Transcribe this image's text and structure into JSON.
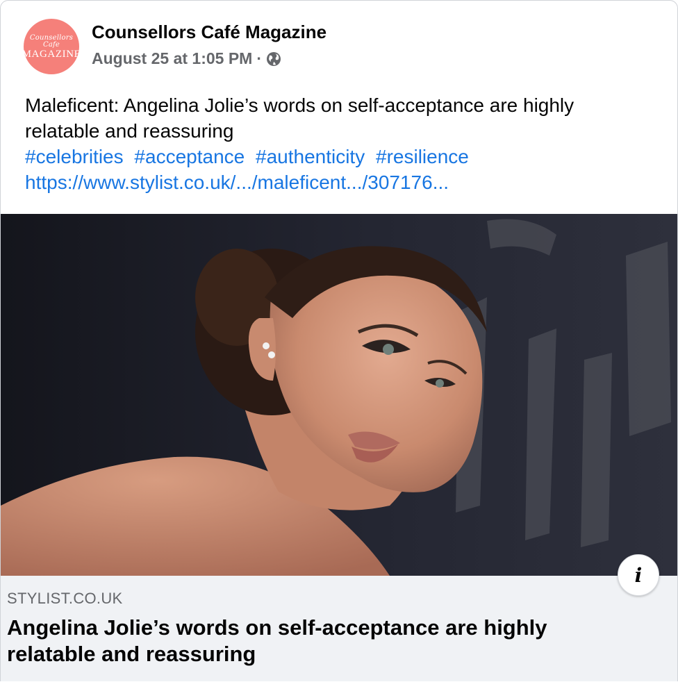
{
  "post": {
    "avatar": {
      "script_text": "Counsellors Cafe",
      "word_text": "MAGAZINE",
      "color": "#f5807a"
    },
    "page_name": "Counsellors Café Magazine",
    "timestamp": "August 25 at 1:05 PM",
    "separator": "·",
    "privacy_icon": "globe-icon",
    "text_line_1": "Maleficent: Angelina Jolie’s words on self-acceptance are highly",
    "text_line_2": "relatable and reassuring",
    "hashtags": [
      "#celebrities",
      "#acceptance",
      "#authenticity",
      "#resilience"
    ],
    "url": "https://www.stylist.co.uk/.../maleficent.../307176...",
    "link_color": "#1876e2"
  },
  "link_preview": {
    "image_alt": "Angelina Jolie at a premiere",
    "info_icon": "info-icon",
    "info_label": "i",
    "domain": "STYLIST.CO.UK",
    "title": "Angelina Jolie’s words on self-acceptance are highly relatable and reassuring"
  }
}
